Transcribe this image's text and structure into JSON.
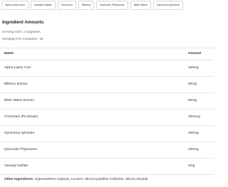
{
  "tags": [
    "Alpha-Lipoic Acid",
    "Vanadyl Sulfate",
    "Chromium",
    "Bilberry",
    "Quercetin Phytosome",
    "Bitter Melon",
    "Gymnema sylvestre"
  ],
  "section": {
    "title": "Ingredient Amounts",
    "serving_size": "Serving Size: 2 Capsules",
    "servings_per_container": "Servings Per Container: 45"
  },
  "table": {
    "headers": {
      "name": "Name",
      "amount": "Amount"
    },
    "rows": [
      {
        "name": "Alpha-Lipoic Acid",
        "amount": "100mg"
      },
      {
        "name": "Bilberry Extract",
        "amount": "80mg"
      },
      {
        "name": "Bitter Melon Extract",
        "amount": "80mg"
      },
      {
        "name": "Chromium (Picolinate)",
        "amount": "200mcg"
      },
      {
        "name": "Gymnema sylvestre",
        "amount": "200mg"
      },
      {
        "name": "Quercetin Phytosome",
        "amount": "200mg"
      },
      {
        "name": "Vanadyl Sulfate",
        "amount": "3mg"
      }
    ]
  },
  "other_ingredients": {
    "label": "Other Ingredients:",
    "value": "Hypromellose Capsule, Leucine, Microcrystalline Cellulose, Silicon Dioxide"
  }
}
